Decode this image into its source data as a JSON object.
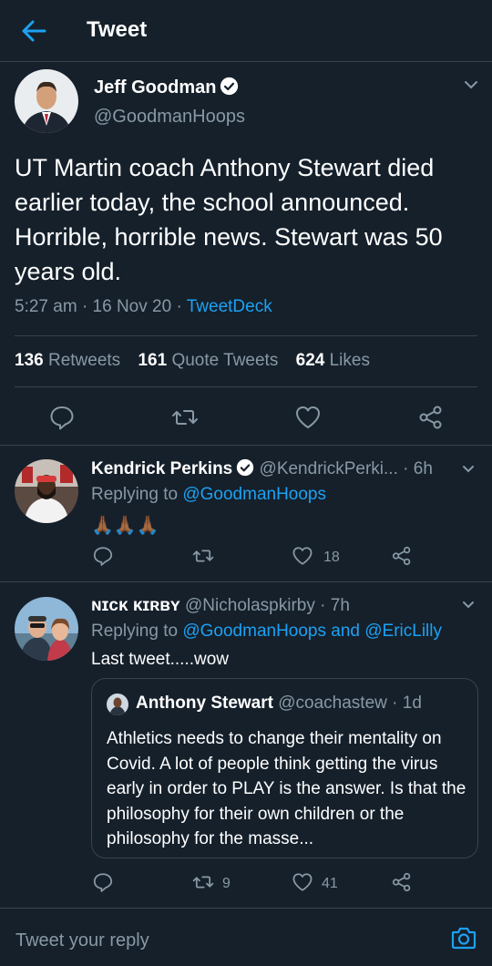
{
  "header": {
    "title": "Tweet"
  },
  "main_tweet": {
    "name": "Jeff Goodman",
    "handle": "@GoodmanHoops",
    "text": "UT Martin coach Anthony Stewart died earlier today, the school announced. Horrible, horrible news. Stewart was 50 years old.",
    "time": "5:27 am",
    "sep1": "·",
    "date": "16 Nov 20",
    "sep2": "·",
    "source": "TweetDeck",
    "stats": {
      "retweets_count": "136",
      "retweets_label": "Retweets",
      "quotes_count": "161",
      "quotes_label": "Quote Tweets",
      "likes_count": "624",
      "likes_label": "Likes"
    }
  },
  "replies": [
    {
      "name": "Kendrick Perkins",
      "handle": "@KendrickPerki...",
      "sep": "·",
      "time": "6h",
      "replying_prefix": "Replying to",
      "replying_to": "@GoodmanHoops",
      "text": "🙏🏾🙏🏾🙏🏾",
      "likes": "18"
    },
    {
      "name": "ɴɪᴄᴋ ᴋɪʀʙʏ",
      "handle": "@Nicholaspkirby",
      "sep": "·",
      "time": "7h",
      "replying_prefix": "Replying to",
      "replying_to": "@GoodmanHoops and @EricLilly",
      "text": "Last tweet.....wow",
      "retweets": "9",
      "likes": "41",
      "quote": {
        "name": "Anthony Stewart",
        "handle": "@coachastew",
        "sep": "·",
        "time": "1d",
        "text": "Athletics needs to change their mentality on Covid. A lot of people think getting the virus early in order to PLAY is the answer. Is that the philosophy for their own children or the philosophy for the masse..."
      }
    }
  ],
  "composer": {
    "placeholder": "Tweet your reply"
  },
  "colors": {
    "background": "#15202b",
    "accent": "#1da1f2",
    "muted": "#8899a6",
    "border": "#38444d"
  }
}
